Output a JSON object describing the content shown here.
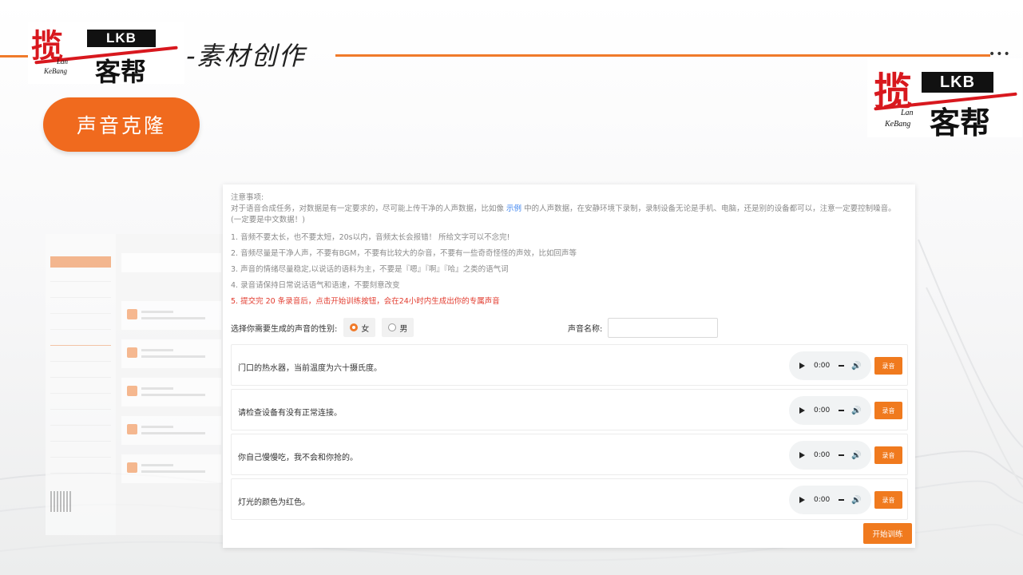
{
  "header": {
    "title": "-素材创作",
    "dots": "•••",
    "logo": {
      "main_char": "揽",
      "badge": "LKB",
      "sub_chars": "客帮",
      "lan": "Lan",
      "kebang": "KeBang"
    }
  },
  "section_pill": {
    "label": "声音克隆"
  },
  "notes": {
    "heading": "注意事项:",
    "intro_pre": "对于语音合成任务，对数据是有一定要求的，尽可能上传干净的人声数据，比如像",
    "intro_link": "示例",
    "intro_post": "中的人声数据，在安静环境下录制，录制设备无论是手机、电脑，还是别的设备都可以，注意一定要控制噪音。",
    "intro_line2": "(一定要是中文数据！)",
    "items": [
      "1. 音频不要太长，也不要太短，20s以内，音频太长会报错！ 所给文字可以不念完!",
      "2. 音频尽量是干净人声，不要有BGM，不要有比较大的杂音，不要有一些奇奇怪怪的声效，比如回声等",
      "3. 声音的情绪尽量稳定,以说话的语料为主，不要是『嗯』『啊』『哈』之类的语气词",
      "4. 录音请保持日常说话语气和语速，不要刻意改变"
    ],
    "item_red": "5. 提交完 20 条录音后，点击开始训练按钮，会在24小时内生成出你的专属声音"
  },
  "form": {
    "gender_label": "选择你需要生成的声音的性别:",
    "gender_options": [
      "女",
      "男"
    ],
    "gender_selected": "女",
    "voice_name_label": "声音名称:",
    "voice_name_value": ""
  },
  "recordings": [
    {
      "text": "门口的热水器，当前温度为六十摄氏度。",
      "time": "0:00",
      "button": "录音"
    },
    {
      "text": "请检查设备有没有正常连接。",
      "time": "0:00",
      "button": "录音"
    },
    {
      "text": "你自己慢慢吃，我不会和你抢的。",
      "time": "0:00",
      "button": "录音"
    },
    {
      "text": "灯光的颜色为红色。",
      "time": "0:00",
      "button": "录音"
    }
  ],
  "train_button": "开始训练",
  "colors": {
    "accent": "#f07a1e",
    "logo_red": "#d8181e",
    "link": "#3a82f0",
    "warning": "#e23b2e"
  },
  "icons": [
    "play-icon",
    "volume-icon",
    "radio-icon"
  ]
}
